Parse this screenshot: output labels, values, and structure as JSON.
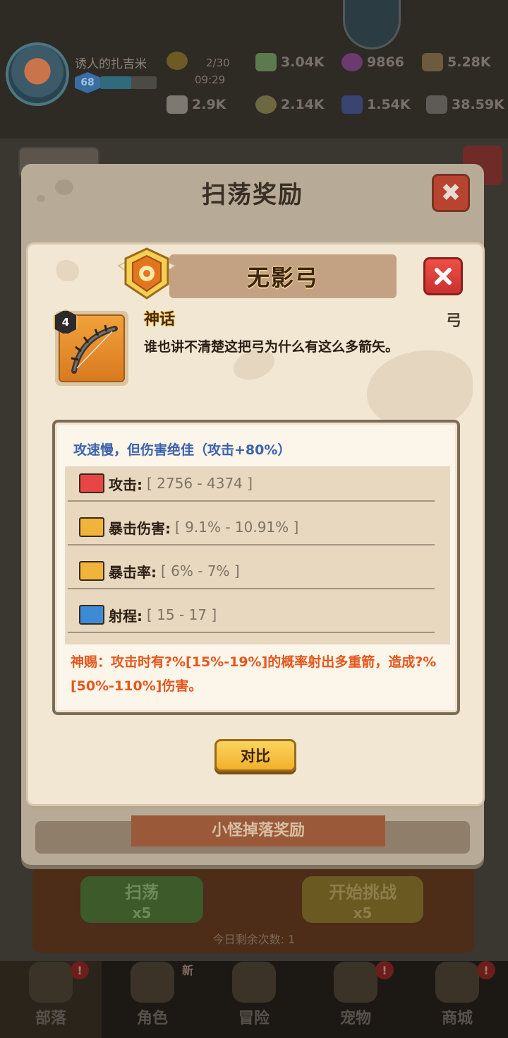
{
  "player": {
    "name": "诱人的扎吉米",
    "level": "68"
  },
  "stamina": {
    "count": "2/30",
    "timer": "09:29"
  },
  "resources": [
    {
      "name": "green-gem",
      "value": "3.04K",
      "color": "#5d7a4e"
    },
    {
      "name": "purple-orb",
      "value": "9866",
      "color": "#6b3a6e"
    },
    {
      "name": "wood",
      "value": "5.28K",
      "color": "#6e5a3e"
    },
    {
      "name": "bone",
      "value": "2.9K",
      "color": "#7d7870"
    },
    {
      "name": "gold-coin",
      "value": "2.14K",
      "color": "#6e6840"
    },
    {
      "name": "crystal",
      "value": "1.54K",
      "color": "#3a4470"
    },
    {
      "name": "stone",
      "value": "38.59K",
      "color": "#5e5a55"
    }
  ],
  "outer_modal": {
    "title": "扫荡奖励",
    "close_symbol": "✖",
    "subheading": "小怪掉落奖励"
  },
  "item": {
    "name": "无影弓",
    "rarity": "神话",
    "type": "弓",
    "level": "4",
    "description": "谁也讲不清楚这把弓为什么有这么多箭矢。",
    "headline": "攻速慢，但伤害绝佳（攻击+80%）",
    "stats": [
      {
        "name": "攻击:",
        "range": "[ 2756 - 4374 ]",
        "icon": "attack-icon",
        "color": "#e84646"
      },
      {
        "name": "暴击伤害:",
        "range": "[ 9.1% - 10.91% ]",
        "icon": "crit-damage-icon",
        "color": "#f0b43a"
      },
      {
        "name": "暴击率:",
        "range": "[ 6% - 7% ]",
        "icon": "crit-rate-icon",
        "color": "#f0b43a"
      },
      {
        "name": "射程:",
        "range": "[ 15 - 17 ]",
        "icon": "range-icon",
        "color": "#3d8bd6"
      }
    ],
    "special": "神赐：攻击时有?%[15%-19%]的概率射出多重箭，造成?%[50%-110%]伤害。",
    "compare_label": "对比"
  },
  "actions": {
    "sweep_label": "扫荡",
    "sweep_cost": "x5",
    "challenge_label": "开始挑战",
    "challenge_cost": "x5",
    "remaining": "今日剩余次数: 1"
  },
  "nav": [
    {
      "label": "部落",
      "badge": "!",
      "active": true
    },
    {
      "label": "角色",
      "badge": "新"
    },
    {
      "label": "冒险",
      "badge": ""
    },
    {
      "label": "宠物",
      "badge": "!"
    },
    {
      "label": "商城",
      "badge": "!"
    }
  ]
}
